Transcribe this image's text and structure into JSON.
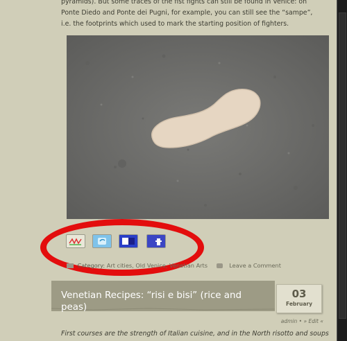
{
  "article": {
    "intro_line1": "pyramids). But some traces of the fist fights can still be found in Venice: on",
    "intro_line2": "Ponte Diedo and Ponte dei Pugni, for example, you can still see the “sampe”,",
    "intro_line3": "i.e. the footprints which used to mark the starting position of fighters."
  },
  "photo": {
    "subject": "white footprint on grey stone pavement",
    "colors": {
      "stone": "#727270",
      "footprint": "#e6d6c2"
    }
  },
  "share": {
    "icons": [
      {
        "name": "delicious-icon"
      },
      {
        "name": "twitter-icon"
      },
      {
        "name": "stumbleupon-icon"
      },
      {
        "name": "facebook-icon"
      }
    ]
  },
  "annotation": {
    "color": "#e30d0d"
  },
  "meta": {
    "category_prefix": "Category:",
    "categories": "Art cities, Old Venice, Venetian Arts",
    "comment_link": "Leave a Comment"
  },
  "next_post": {
    "title": "Venetian Recipes: “risi e bisi” (rice and peas)",
    "date_day": "03",
    "date_month": "February",
    "byline": "admin • » Edit «",
    "excerpt": "First courses are the strength of Italian cuisine, and in the North risotto and soups"
  }
}
